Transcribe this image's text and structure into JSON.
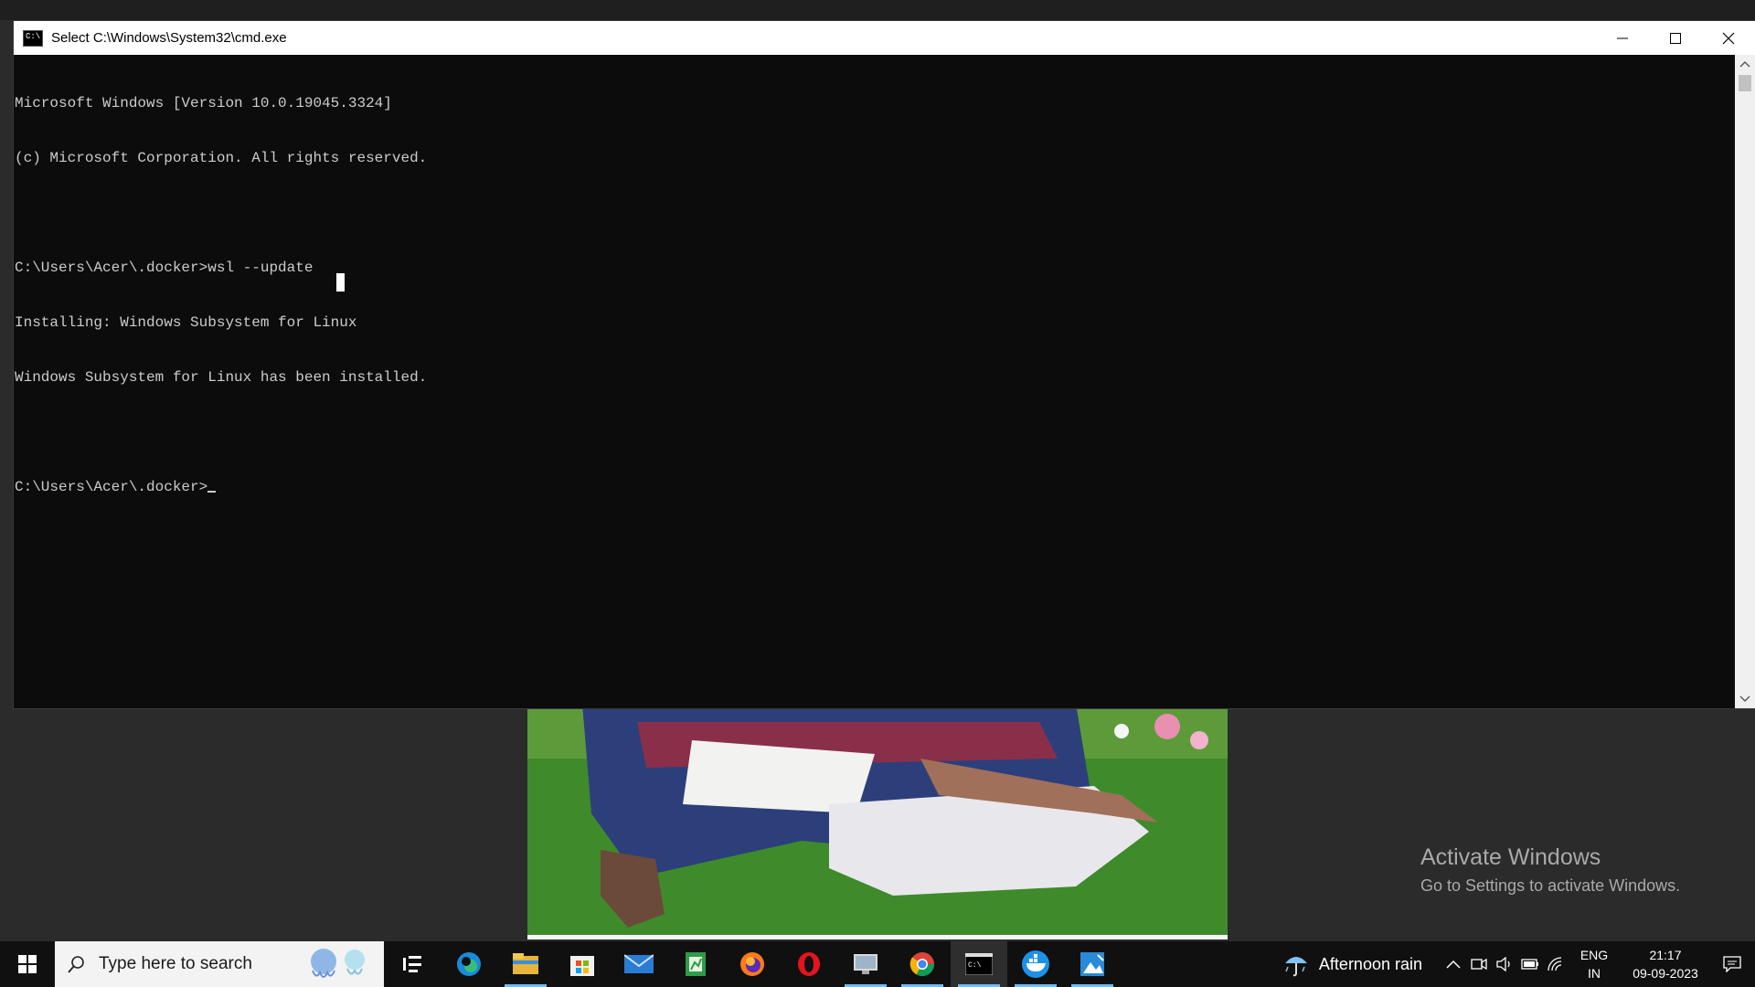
{
  "window": {
    "title": "Select C:\\Windows\\System32\\cmd.exe",
    "icon": "cmd-icon",
    "controls": [
      "minimize-icon",
      "maximize-icon",
      "close-icon"
    ]
  },
  "console": {
    "lines": [
      "Microsoft Windows [Version 10.0.19045.3324]",
      "(c) Microsoft Corporation. All rights reserved.",
      "",
      "C:\\Users\\Acer\\.docker>wsl --update",
      "Installing: Windows Subsystem for Linux",
      "Windows Subsystem for Linux has been installed.",
      "",
      "C:\\Users\\Acer\\.docker>"
    ]
  },
  "desktop": {
    "activate_title": "Activate Windows",
    "activate_subtitle": "Go to Settings to activate Windows."
  },
  "taskbar": {
    "search_placeholder": "Type here to search",
    "apps": [
      {
        "name": "task-view-icon"
      },
      {
        "name": "edge-icon"
      },
      {
        "name": "file-explorer-icon",
        "running": true
      },
      {
        "name": "microsoft-store-icon"
      },
      {
        "name": "mail-icon"
      },
      {
        "name": "spreadsheet-app-icon"
      },
      {
        "name": "firefox-icon"
      },
      {
        "name": "opera-icon"
      },
      {
        "name": "remote-desktop-icon",
        "running": true
      },
      {
        "name": "chrome-icon",
        "running": true
      },
      {
        "name": "command-prompt-icon",
        "running": true,
        "active": true
      },
      {
        "name": "docker-icon",
        "running": true
      },
      {
        "name": "photos-icon",
        "running": true
      }
    ],
    "weather": "Afternoon rain",
    "lang_top": "ENG",
    "lang_bottom": "IN",
    "time": "21:17",
    "date": "09-09-2023"
  }
}
